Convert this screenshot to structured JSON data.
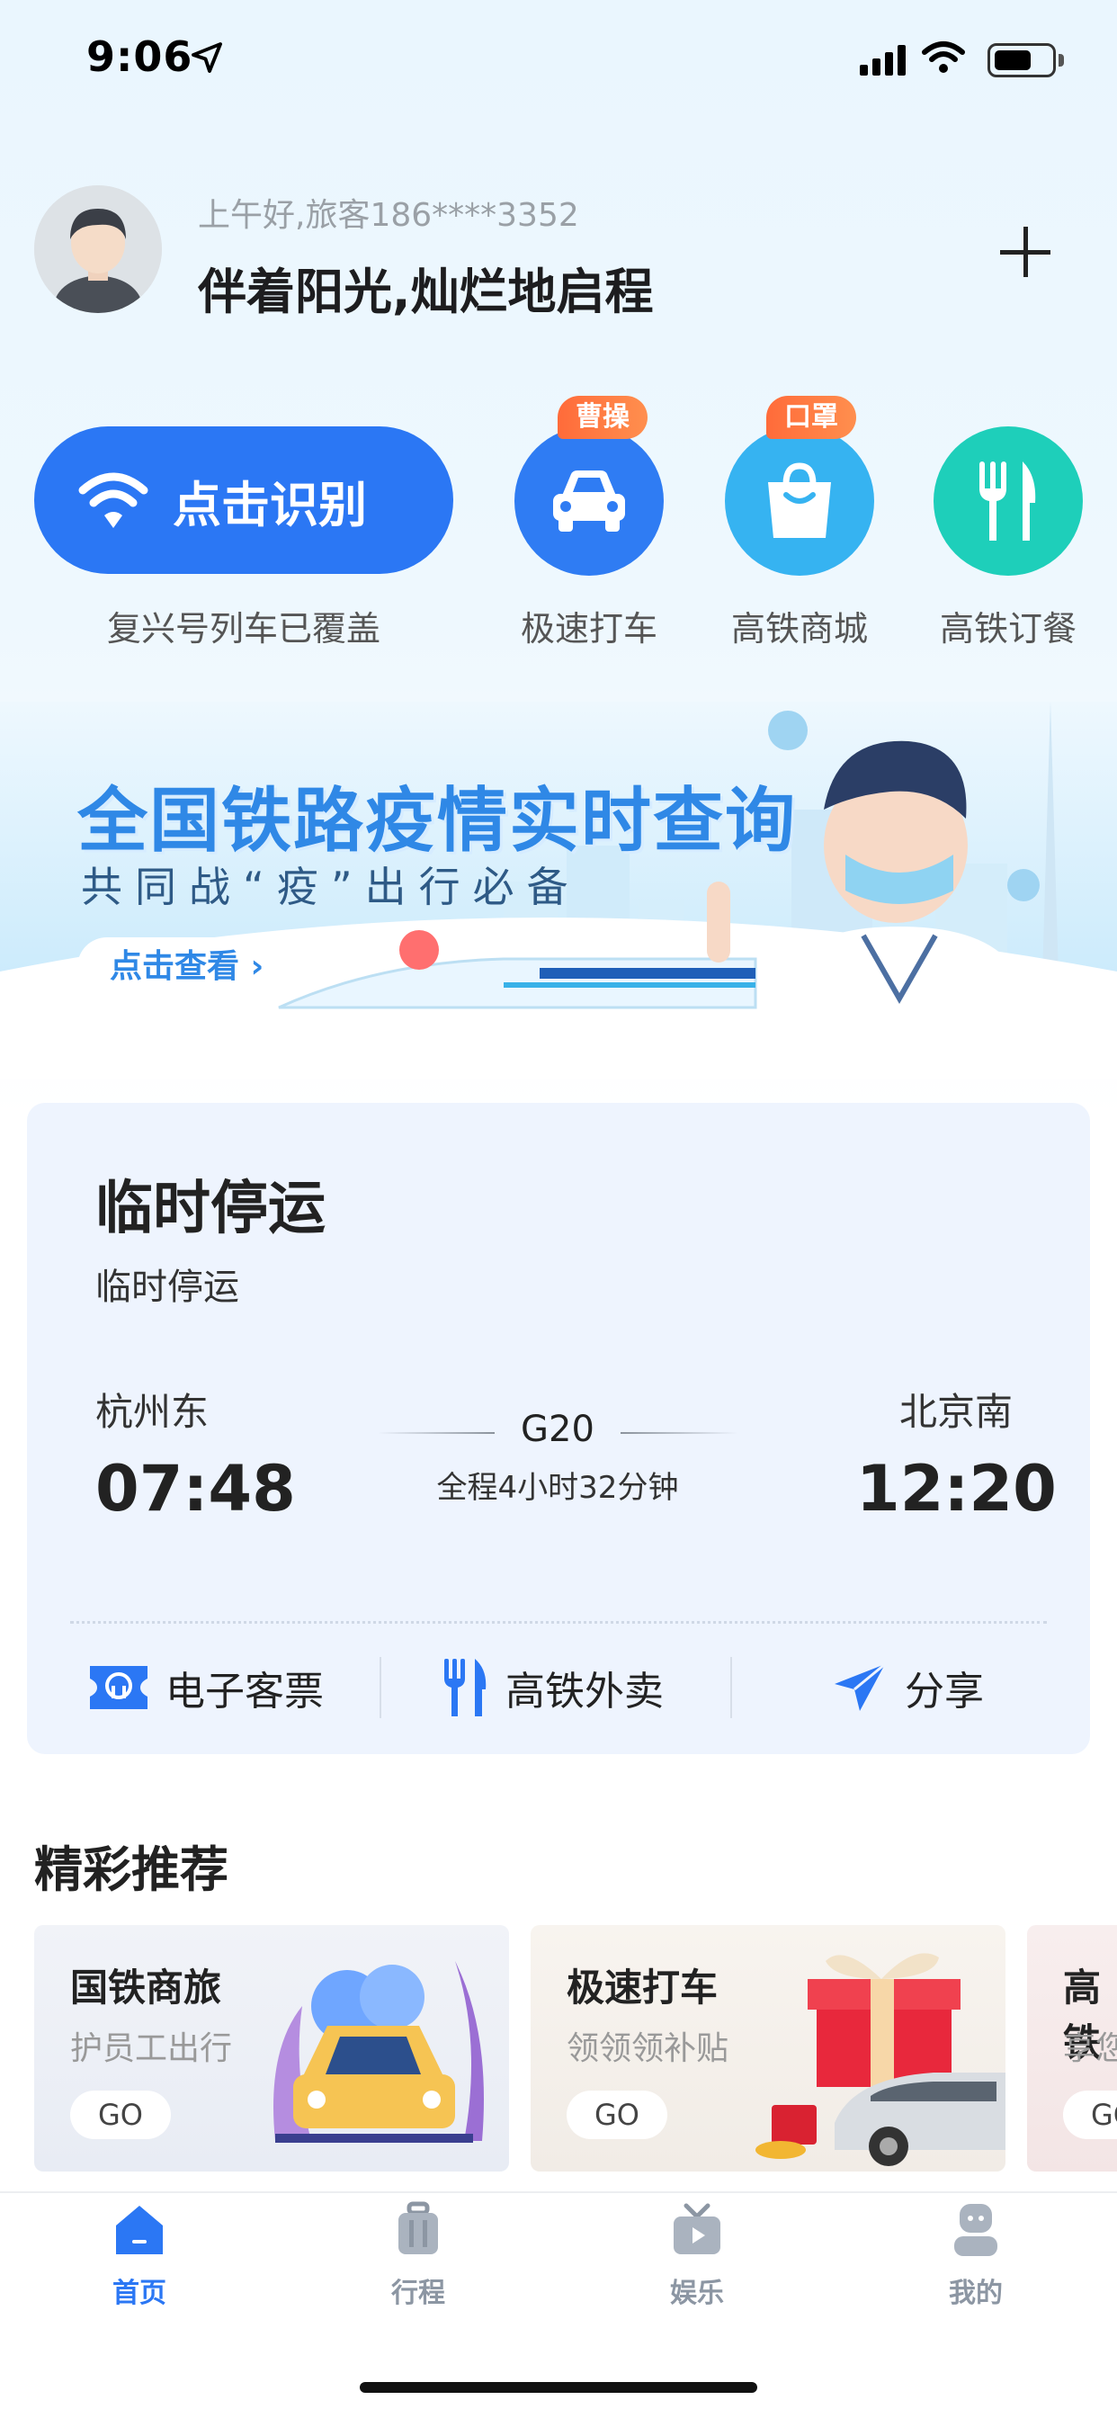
{
  "status_bar": {
    "time": "9:06"
  },
  "header": {
    "greeting": "上午好,旅客186****3352",
    "motto": "伴着阳光,灿烂地启程"
  },
  "quick_actions": {
    "identify_label": "点击识别",
    "identify_caption": "复兴号列车已覆盖",
    "items": [
      {
        "label": "极速打车",
        "tag": "曹操",
        "icon": "car-icon",
        "color": "#2f7cf3"
      },
      {
        "label": "高铁商城",
        "tag": "口罩",
        "icon": "shopping-bag-icon",
        "color": "#36b3f1"
      },
      {
        "label": "高铁订餐",
        "tag": "",
        "icon": "fork-knife-icon",
        "color": "#1ecfba"
      }
    ]
  },
  "banner": {
    "title": "全国铁路疫情实时查询",
    "subtitle": "共同战“疫”出行必备",
    "button": "点击查看 ›"
  },
  "trip": {
    "title": "临时停运",
    "subtitle": "临时停运",
    "from_station": "杭州东",
    "to_station": "北京南",
    "dep_time": "07:48",
    "arr_time": "12:20",
    "train_no": "G20",
    "duration": "全程4小时32分钟",
    "actions": [
      {
        "label": "电子客票",
        "icon": "railway-ticket-icon"
      },
      {
        "label": "高铁外卖",
        "icon": "fork-knife-icon"
      },
      {
        "label": "分享",
        "icon": "share-plane-icon"
      }
    ]
  },
  "recommend": {
    "title": "精彩推荐",
    "cards": [
      {
        "title": "国铁商旅",
        "subtitle": "护员工出行",
        "go": "GO"
      },
      {
        "title": "极速打车",
        "subtitle": "领领领补贴",
        "go": "GO"
      },
      {
        "title": "高铁",
        "subtitle": "享您",
        "go": "GO"
      }
    ]
  },
  "tabbar": {
    "items": [
      {
        "label": "首页",
        "icon": "home-icon",
        "active": true
      },
      {
        "label": "行程",
        "icon": "luggage-icon",
        "active": false
      },
      {
        "label": "娱乐",
        "icon": "tv-play-icon",
        "active": false
      },
      {
        "label": "我的",
        "icon": "profile-icon",
        "active": false
      }
    ],
    "active_color": "#2b77f4",
    "inactive_color": "#8c96a3"
  }
}
